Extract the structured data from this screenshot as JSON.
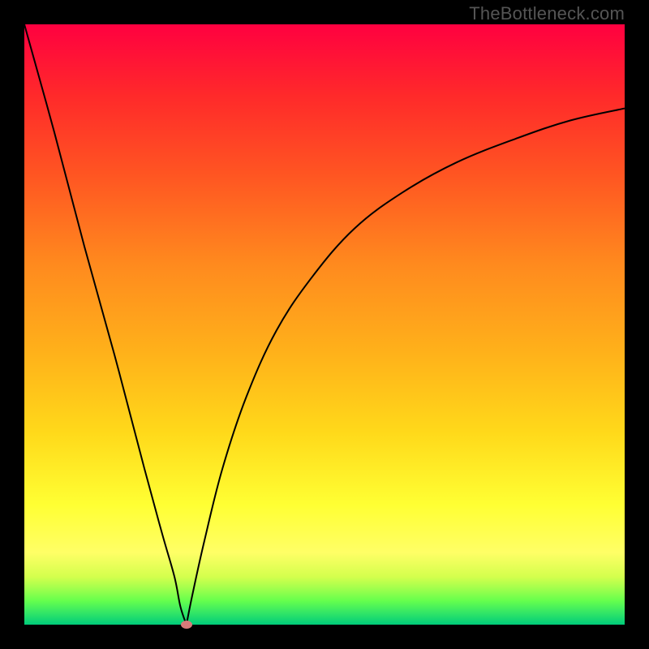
{
  "attribution": "TheBottleneck.com",
  "chart_data": {
    "type": "line",
    "title": "",
    "xlabel": "",
    "ylabel": "",
    "xlim": [
      0,
      100
    ],
    "ylim": [
      0,
      100
    ],
    "grid": false,
    "legend": false,
    "notes": "Background is a vertical gradient from red (high values) through orange/yellow to green (low values). Two black curve segments form a V with a minimum near x≈27. A small desaturated-red oval marker sits at the minimum.",
    "series": [
      {
        "name": "left-branch",
        "x": [
          0,
          5,
          10,
          15,
          20,
          23,
          25,
          26,
          27
        ],
        "values": [
          100,
          82,
          63,
          45,
          26,
          15,
          8,
          3,
          0
        ]
      },
      {
        "name": "right-branch",
        "x": [
          27,
          28,
          30,
          33,
          37,
          42,
          48,
          55,
          63,
          72,
          82,
          91,
          100
        ],
        "values": [
          0,
          5,
          14,
          26,
          38,
          49,
          58,
          66,
          72,
          77,
          81,
          84,
          86
        ]
      }
    ],
    "marker": {
      "x": 27,
      "y": 0
    },
    "gradient_stops": [
      {
        "pct": 0,
        "color": "#ff0040"
      },
      {
        "pct": 12,
        "color": "#ff2a2a"
      },
      {
        "pct": 25,
        "color": "#ff5522"
      },
      {
        "pct": 40,
        "color": "#ff8a1e"
      },
      {
        "pct": 55,
        "color": "#ffb21a"
      },
      {
        "pct": 68,
        "color": "#ffd91a"
      },
      {
        "pct": 80,
        "color": "#ffff33"
      },
      {
        "pct": 88,
        "color": "#ffff66"
      },
      {
        "pct": 92,
        "color": "#d4ff4d"
      },
      {
        "pct": 94,
        "color": "#a0ff4d"
      },
      {
        "pct": 96,
        "color": "#66ff4d"
      },
      {
        "pct": 98,
        "color": "#33e666"
      },
      {
        "pct": 100,
        "color": "#00cc7a"
      }
    ]
  }
}
